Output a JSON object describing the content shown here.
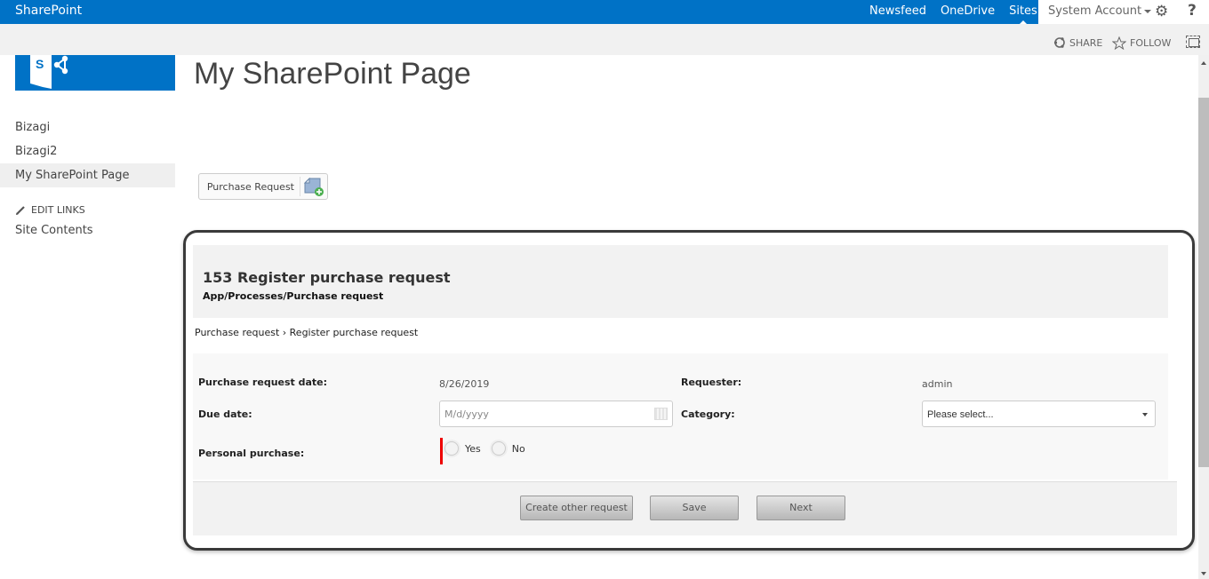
{
  "suitebar": {
    "brand": "SharePoint",
    "links": [
      {
        "label": "Newsfeed",
        "active": false
      },
      {
        "label": "OneDrive",
        "active": false
      },
      {
        "label": "Sites",
        "active": true
      }
    ],
    "account": "System Account",
    "icons": {
      "settings": "gear-icon",
      "help": "help-icon"
    },
    "accent_color": "#0072c6"
  },
  "ribbon": {
    "share_label": "SHARE",
    "follow_label": "FOLLOW"
  },
  "page": {
    "title": "My SharePoint Page"
  },
  "quick_launch": {
    "items": [
      {
        "label": "Bizagi",
        "selected": false
      },
      {
        "label": "Bizagi2",
        "selected": false
      },
      {
        "label": "My SharePoint Page",
        "selected": true
      }
    ],
    "edit_links_label": "EDIT LINKS",
    "site_contents_label": "Site Contents"
  },
  "app_button": {
    "label": "Purchase Request"
  },
  "form": {
    "title": "153 Register purchase request",
    "path": "App/Processes/Purchase request",
    "breadcrumb": "Purchase request › Register purchase request",
    "fields": {
      "purchase_request_date": {
        "label": "Purchase request date:",
        "value": "8/26/2019"
      },
      "requester": {
        "label": "Requester:",
        "value": "admin"
      },
      "due_date": {
        "label": "Due date:",
        "value": "",
        "placeholder": "M/d/yyyy"
      },
      "category": {
        "label": "Category:",
        "selected": "Please select..."
      },
      "personal_purchase": {
        "label": "Personal purchase:",
        "options": [
          "Yes",
          "No"
        ],
        "required": true,
        "required_color": "#e00000"
      }
    },
    "buttons": {
      "create_other": "Create other request",
      "save": "Save",
      "next": "Next"
    }
  }
}
